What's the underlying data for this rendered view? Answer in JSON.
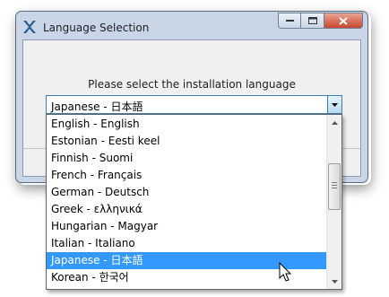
{
  "window": {
    "title": "Language Selection",
    "app_icon": "installer-x-icon",
    "controls": {
      "minimize": "minimize-icon",
      "maximize": "maximize-icon",
      "close": "close-icon"
    }
  },
  "dialog": {
    "prompt": "Please select the installation language",
    "combo": {
      "selected": "Japanese - 日本語",
      "arrow_icon": "chevron-down-icon"
    }
  },
  "dropdown": {
    "items": [
      "English - English",
      "Estonian - Eesti keel",
      "Finnish - Suomi",
      "French - Français",
      "German - Deutsch",
      "Greek - ελληνικά",
      "Hungarian - Magyar",
      "Italian - Italiano",
      "Japanese - 日本語",
      "Korean - 한국어"
    ],
    "highlighted_index": 8
  },
  "colors": {
    "selection": "#3399ff",
    "titlebar": "#c8d6e8",
    "close_button": "#c8472d"
  }
}
